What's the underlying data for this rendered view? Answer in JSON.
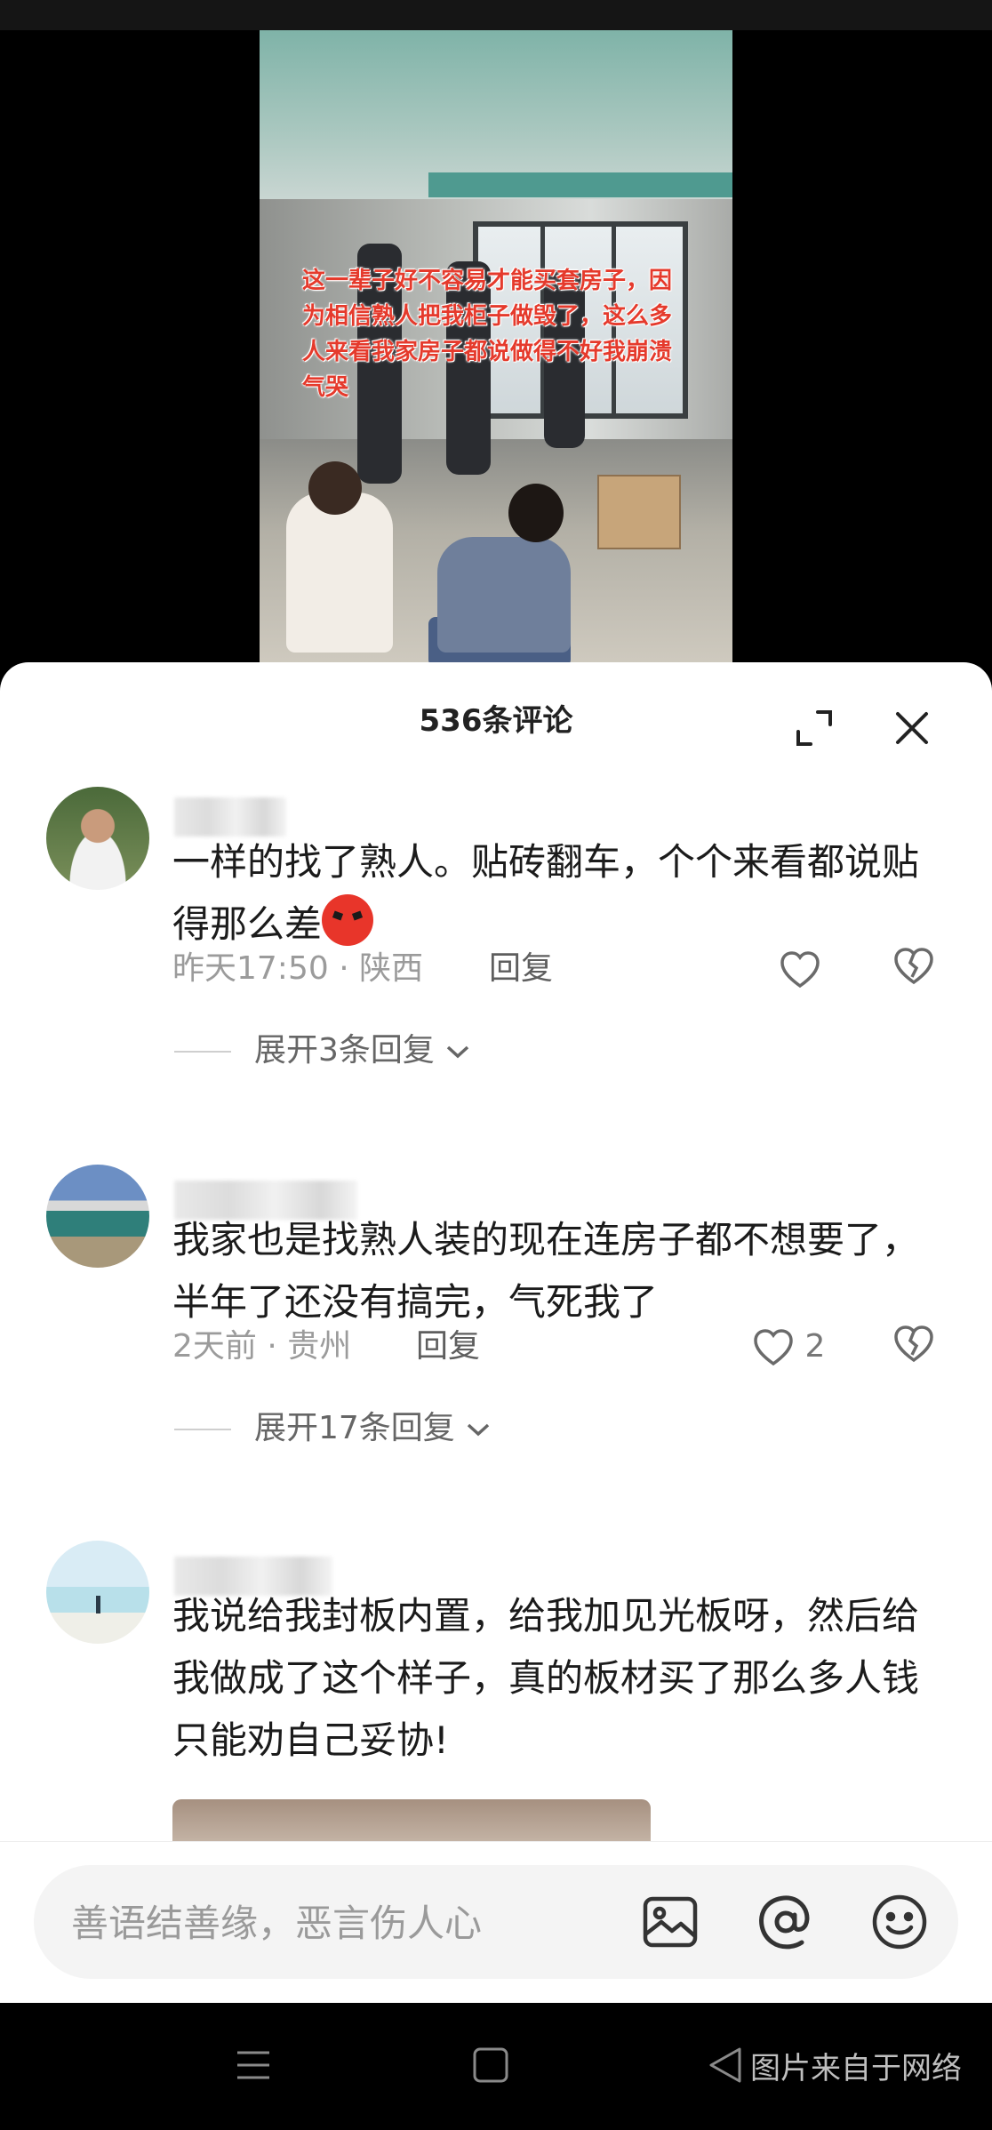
{
  "video": {
    "caption": "这一辈子好不容易才能买套房子，因为相信熟人把我柜子做毁了，这么多人来看我家房子都说做得不好我崩溃气哭"
  },
  "comments_panel": {
    "title": "536条评论",
    "expand_icon": "expand-icon",
    "close_icon": "close-icon"
  },
  "comments": [
    {
      "text": "一样的找了熟人。贴砖翻车，个个来看都说贴得那么差",
      "emoji": "angry-face-emoji",
      "meta": "昨天17:50 · 陕西",
      "reply_label": "回复",
      "like_count": "",
      "expand_label": "展开3条回复"
    },
    {
      "text": "我家也是找熟人装的现在连房子都不想要了，半年了还没有搞完，气死我了",
      "meta": "2天前 · 贵州",
      "reply_label": "回复",
      "like_count": "2",
      "expand_label": "展开17条回复"
    },
    {
      "text": "我说给我封板内置，给我加见光板呀，然后给我做成了这个样子，真的板材买了那么多人钱只能劝自己妥协!"
    }
  ],
  "input": {
    "placeholder": "善语结善缘，恶言伤人心",
    "icons": [
      "image-icon",
      "at-icon",
      "emoji-icon"
    ]
  },
  "nav": {
    "watermark": "图片来自于网络",
    "icons": [
      "menu-icon",
      "home-icon",
      "back-icon"
    ]
  },
  "colors": {
    "caption_red": "#e53a2c",
    "sheet_bg": "#ffffff",
    "meta_gray": "#9b9b9b"
  }
}
